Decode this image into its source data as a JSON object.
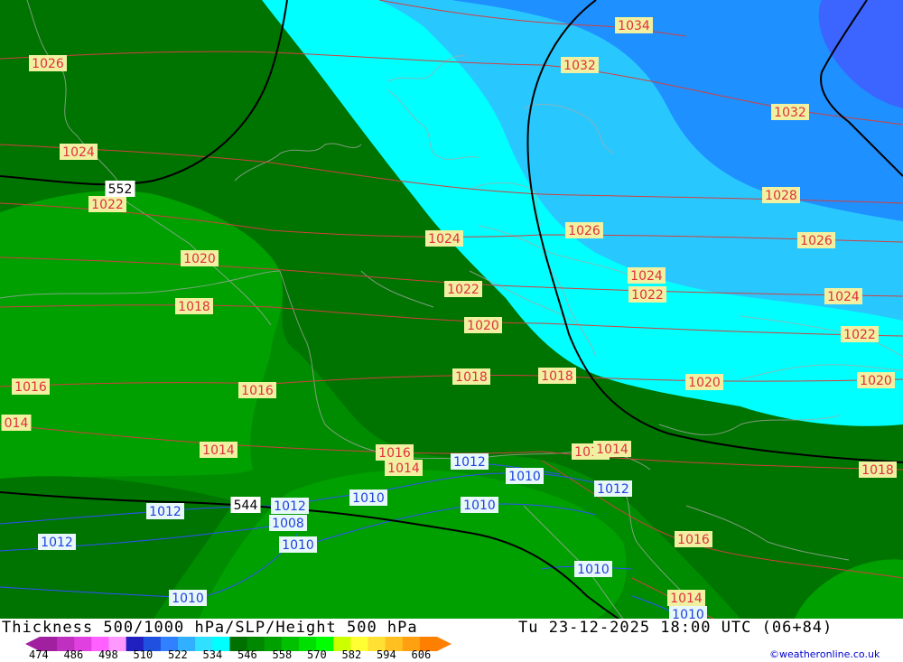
{
  "title": "Thickness 500/1000 hPa/SLP/Height 500 hPa",
  "datetime": "Tu 23-12-2025 18:00 UTC (06+84)",
  "credit": "©weatheronline.co.uk",
  "legend": {
    "colors": [
      "#a020a0",
      "#c030c0",
      "#e040e0",
      "#ff60ff",
      "#ff99ff",
      "#2020c0",
      "#2050e0",
      "#3080ff",
      "#30b0ff",
      "#30e0ff",
      "#00ffff",
      "#007000",
      "#008800",
      "#00a000",
      "#00c000",
      "#00e000",
      "#00ff00",
      "#ccff00",
      "#ffff33",
      "#ffe033",
      "#ffc020",
      "#ffa010",
      "#ff8000"
    ],
    "ticks": [
      "474",
      "486",
      "498",
      "510",
      "522",
      "534",
      "546",
      "558",
      "570",
      "582",
      "594",
      "606"
    ]
  },
  "map_colors": {
    "thickness_534": "#007400",
    "thickness_540": "#008c00",
    "thickness_546": "#00a000",
    "thickness_522": "#00ffff",
    "thickness_516": "#28c8ff",
    "thickness_510": "#1e90ff",
    "thickness_504": "#3c64ff",
    "isobar_high": "#d04040",
    "isobar_low": "#3050ff",
    "height_500": "#000000",
    "borders": "#b0b0b0"
  },
  "slp_labels": [
    {
      "text": "1034",
      "cls": "red"
    },
    {
      "text": "1032",
      "cls": "red"
    },
    {
      "text": "1026",
      "cls": "red"
    },
    {
      "text": "1032",
      "cls": "red"
    },
    {
      "text": "1024",
      "cls": "red"
    },
    {
      "text": "1028",
      "cls": "red"
    },
    {
      "text": "1022",
      "cls": "red"
    },
    {
      "text": "1024",
      "cls": "red"
    },
    {
      "text": "1026",
      "cls": "red"
    },
    {
      "text": "1026",
      "cls": "red"
    },
    {
      "text": "1020",
      "cls": "red"
    },
    {
      "text": "1024",
      "cls": "red"
    },
    {
      "text": "1022",
      "cls": "red"
    },
    {
      "text": "1022",
      "cls": "red"
    },
    {
      "text": "1024",
      "cls": "red"
    },
    {
      "text": "1018",
      "cls": "red"
    },
    {
      "text": "1020",
      "cls": "red"
    },
    {
      "text": "1022",
      "cls": "red"
    },
    {
      "text": "1016",
      "cls": "red"
    },
    {
      "text": "1016",
      "cls": "red"
    },
    {
      "text": "1018",
      "cls": "red"
    },
    {
      "text": "1018",
      "cls": "red"
    },
    {
      "text": "1020",
      "cls": "red"
    },
    {
      "text": "1020",
      "cls": "red"
    },
    {
      "text": "014",
      "cls": "red"
    },
    {
      "text": "1014",
      "cls": "red"
    },
    {
      "text": "1016",
      "cls": "red"
    },
    {
      "text": "1014",
      "cls": "red"
    },
    {
      "text": "1016",
      "cls": "red"
    },
    {
      "text": "1014",
      "cls": "red"
    },
    {
      "text": "1018",
      "cls": "red"
    },
    {
      "text": "1016",
      "cls": "red"
    },
    {
      "text": "1014",
      "cls": "red"
    },
    {
      "text": "1012",
      "cls": "blue"
    },
    {
      "text": "1010",
      "cls": "blue"
    },
    {
      "text": "1012",
      "cls": "blue"
    },
    {
      "text": "1012",
      "cls": "blue"
    },
    {
      "text": "1010",
      "cls": "blue"
    },
    {
      "text": "1010",
      "cls": "blue"
    },
    {
      "text": "1012",
      "cls": "blue"
    },
    {
      "text": "1008",
      "cls": "blue"
    },
    {
      "text": "1012",
      "cls": "blue"
    },
    {
      "text": "1010",
      "cls": "blue"
    },
    {
      "text": "1010",
      "cls": "blue"
    },
    {
      "text": "1010",
      "cls": "blue"
    },
    {
      "text": "1010",
      "cls": "blue"
    }
  ],
  "height_labels": [
    "552",
    "544"
  ]
}
